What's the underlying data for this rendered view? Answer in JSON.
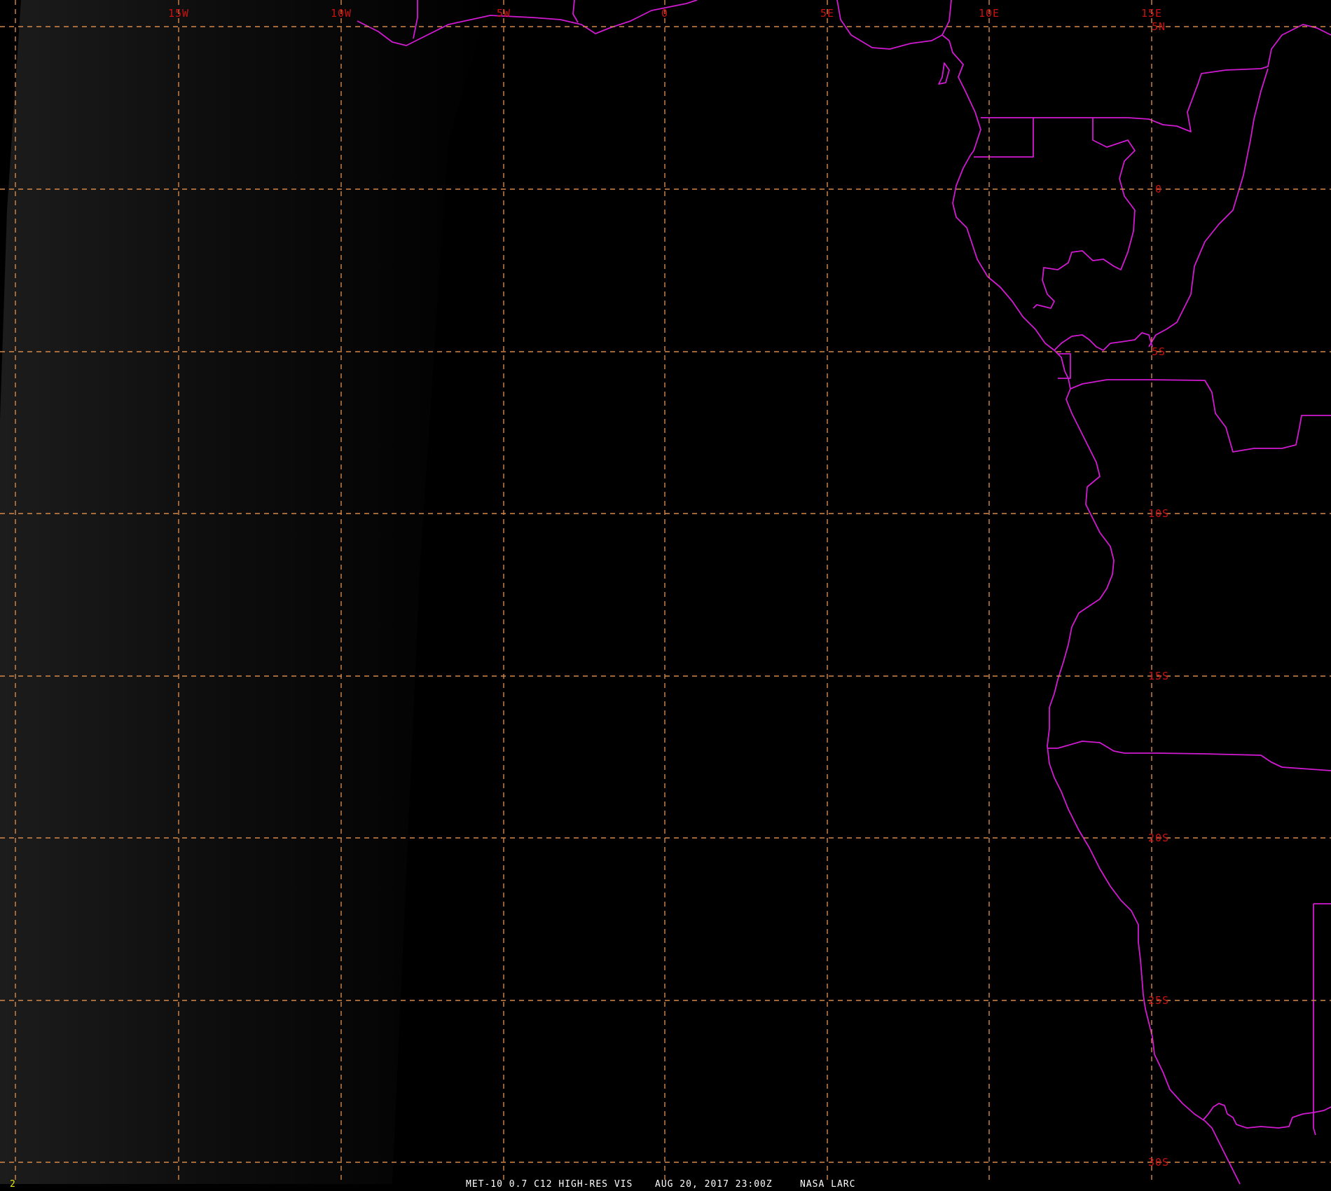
{
  "image": {
    "frame_number": "2",
    "product": "MET-10 0.7 C12 HIGH-RES VIS",
    "timestamp": "AUG 20, 2017 23:00Z",
    "source": "NASA LARC"
  },
  "grid": {
    "longitude_labels": [
      "15W",
      "10W",
      "5W",
      "0",
      "5E",
      "10E",
      "15E"
    ],
    "latitude_labels": [
      "5N",
      "0",
      "5S",
      "10S",
      "15S",
      "20S",
      "25S",
      "30S"
    ]
  },
  "colors": {
    "background": "#000000",
    "grid": "#d4894a",
    "label": "#cc1111",
    "coastline": "#d11ad1",
    "caption": "#ffffff",
    "frame_number": "#e8e800"
  }
}
